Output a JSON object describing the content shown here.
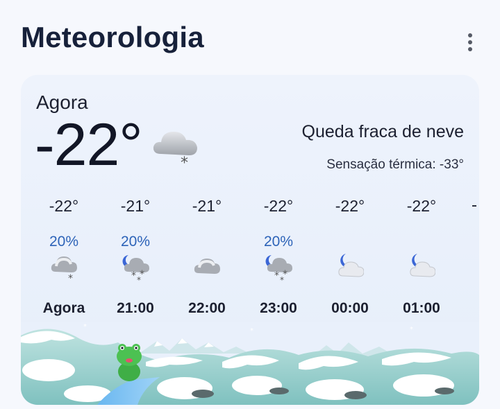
{
  "app": {
    "title": "Meteorologia",
    "menu_icon": "more-vert-icon"
  },
  "current": {
    "label": "Agora",
    "temperature": "-22°",
    "condition": "Queda fraca de neve",
    "feels_like": "Sensação térmica: -33°",
    "icon": "light-snow-icon"
  },
  "hourly": [
    {
      "temp": "-22°",
      "precip": "",
      "icon": "light-snow-icon",
      "time": "Agora"
    },
    {
      "temp": "-21°",
      "precip": "20%",
      "icon": "night-snow-icon",
      "time": "21:00"
    },
    {
      "temp": "-21°",
      "precip": "",
      "icon": "cloud-icon",
      "time": "22:00"
    },
    {
      "temp": "-22°",
      "precip": "20%",
      "icon": "night-snow-icon",
      "time": "23:00"
    },
    {
      "temp": "-22°",
      "precip": "",
      "icon": "night-cloudy-icon",
      "time": "00:00"
    },
    {
      "temp": "-22°",
      "precip": "",
      "icon": "night-cloudy-icon",
      "time": "01:00"
    }
  ],
  "hourly_first_precip": "20%",
  "colors": {
    "precip": "#2d63b8",
    "background": "#f6f8fd",
    "card": "#eef3fc"
  }
}
